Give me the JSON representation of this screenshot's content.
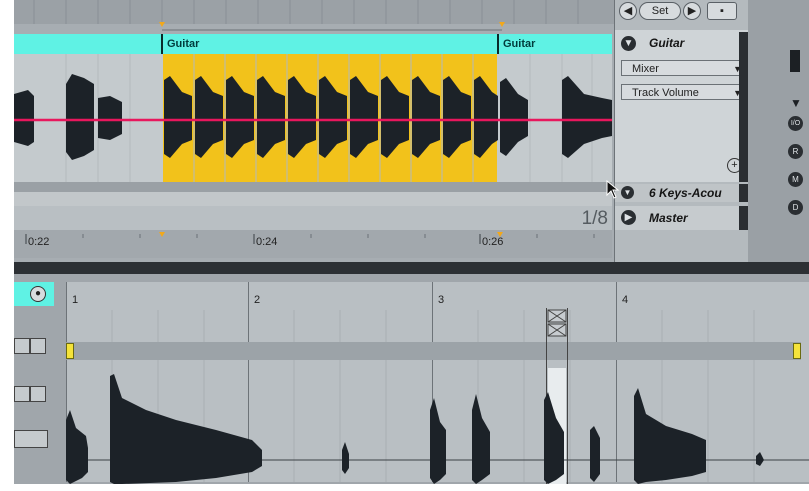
{
  "arrangement": {
    "top_buttons": {
      "set_label": "Set"
    },
    "clips": [
      {
        "label": "Guitar"
      },
      {
        "label": "Guitar"
      }
    ],
    "timeline": [
      "0:22",
      "0:24",
      "0:26"
    ],
    "quantize": "1/8",
    "colors": {
      "clip_bar": "#5ff2e4",
      "selection": "#f2c21b",
      "automation": "#e8175d",
      "waveform": "#1c2228"
    }
  },
  "track_panel": {
    "track_name": "Guitar",
    "device_chooser": "Mixer",
    "parameter_chooser": "Track Volume",
    "next_track": "6 Keys-Acou",
    "master": "Master",
    "side_icons": [
      "I/O",
      "R",
      "M",
      "D"
    ]
  },
  "detail_view": {
    "bar_markers": [
      "1",
      "2",
      "3",
      "4"
    ]
  }
}
